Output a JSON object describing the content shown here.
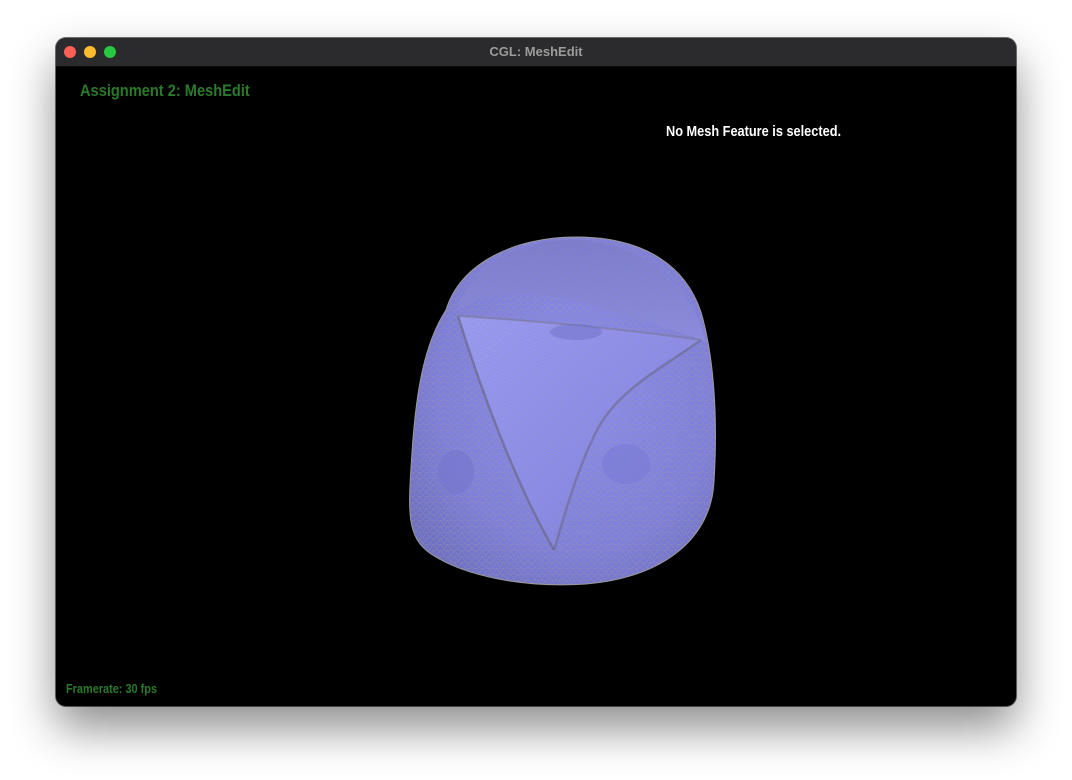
{
  "window": {
    "title": "CGL: MeshEdit"
  },
  "app": {
    "title": "Assignment 2: MeshEdit",
    "status": "No Mesh Feature is selected.",
    "framerate": "Framerate: 30 fps"
  },
  "colors": {
    "background": "#000000",
    "titlebar": "#2b2b2d",
    "title_text": "#9c9c9c",
    "hud_green": "#2b7a2b",
    "hud_white": "#ffffff",
    "mesh_fill": "#8584e6",
    "mesh_wire": "#8a8a8a"
  },
  "icons": {
    "close": "close-icon",
    "minimize": "minimize-icon",
    "zoom": "zoom-icon"
  }
}
